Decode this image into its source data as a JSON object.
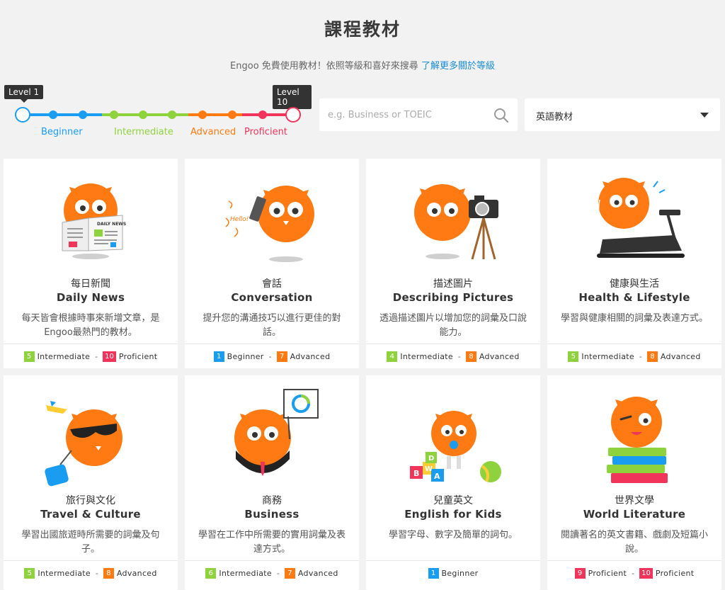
{
  "header": {
    "title": "課程教材",
    "subtitle": "Engoo 免費使用教材！依照等級和喜好來搜尋",
    "link": "了解更多關於等級"
  },
  "slider": {
    "min_label": "Level 1",
    "max_label": "Level 10",
    "levels": [
      {
        "label": "Beginner",
        "color": "#1a9cf0"
      },
      {
        "label": "Intermediate",
        "color": "#8ed33e"
      },
      {
        "label": "Advanced",
        "color": "#ff7a12"
      },
      {
        "label": "Proficient",
        "color": "#f0345a"
      }
    ]
  },
  "search": {
    "placeholder": "e.g. Business or TOEIC",
    "icon": "search-icon"
  },
  "category_select": {
    "value": "英語教材"
  },
  "colors": {
    "beginner": "#1a9cf0",
    "intermediate": "#8ed33e",
    "advanced": "#ff7a12",
    "proficient": "#f0345a",
    "owl": "#ff7a12"
  },
  "courses": [
    {
      "zh": "每日新聞",
      "en": "Daily News",
      "desc": "每天皆會根據時事來新增文章，是Engoo最熱門的教材。",
      "from": {
        "num": "5",
        "label": "Intermediate"
      },
      "to": {
        "num": "10",
        "label": "Proficient"
      },
      "icon": "owl-newspaper-icon"
    },
    {
      "zh": "會話",
      "en": "Conversation",
      "desc": "提升您的溝通技巧以進行更佳的對話。",
      "from": {
        "num": "1",
        "label": "Beginner"
      },
      "to": {
        "num": "7",
        "label": "Advanced"
      },
      "icon": "owl-phone-icon",
      "speech": "Hello!"
    },
    {
      "zh": "描述圖片",
      "en": "Describing Pictures",
      "desc": "透過描述圖片以增加您的詞彙及口說能力。",
      "from": {
        "num": "4",
        "label": "Intermediate"
      },
      "to": {
        "num": "8",
        "label": "Advanced"
      },
      "icon": "owl-camera-icon"
    },
    {
      "zh": "健康與生活",
      "en": "Health & Lifestyle",
      "desc": "學習與健康相關的詞彙及表達方式。",
      "from": {
        "num": "5",
        "label": "Intermediate"
      },
      "to": {
        "num": "8",
        "label": "Advanced"
      },
      "icon": "owl-treadmill-icon"
    },
    {
      "zh": "旅行與文化",
      "en": "Travel & Culture",
      "desc": "學習出國旅遊時所需要的詞彙及句子。",
      "from": {
        "num": "5",
        "label": "Intermediate"
      },
      "to": {
        "num": "8",
        "label": "Advanced"
      },
      "icon": "owl-travel-icon"
    },
    {
      "zh": "商務",
      "en": "Business",
      "desc": "學習在工作中所需要的實用詞彙及表達方式。",
      "from": {
        "num": "6",
        "label": "Intermediate"
      },
      "to": {
        "num": "7",
        "label": "Advanced"
      },
      "icon": "owl-business-icon"
    },
    {
      "zh": "兒童英文",
      "en": "English for Kids",
      "desc": "學習字母、數字及簡單的詞句。",
      "from": {
        "num": "1",
        "label": "Beginner"
      },
      "to": null,
      "icon": "owl-baby-icon",
      "blocks": [
        "B",
        "D",
        "W",
        "A"
      ]
    },
    {
      "zh": "世界文學",
      "en": "World Literature",
      "desc": "閱讀著名的英文書籍、戲劇及短篇小說。",
      "from": {
        "num": "9",
        "label": "Proficient"
      },
      "to": {
        "num": "10",
        "label": "Proficient"
      },
      "icon": "owl-books-icon"
    }
  ]
}
